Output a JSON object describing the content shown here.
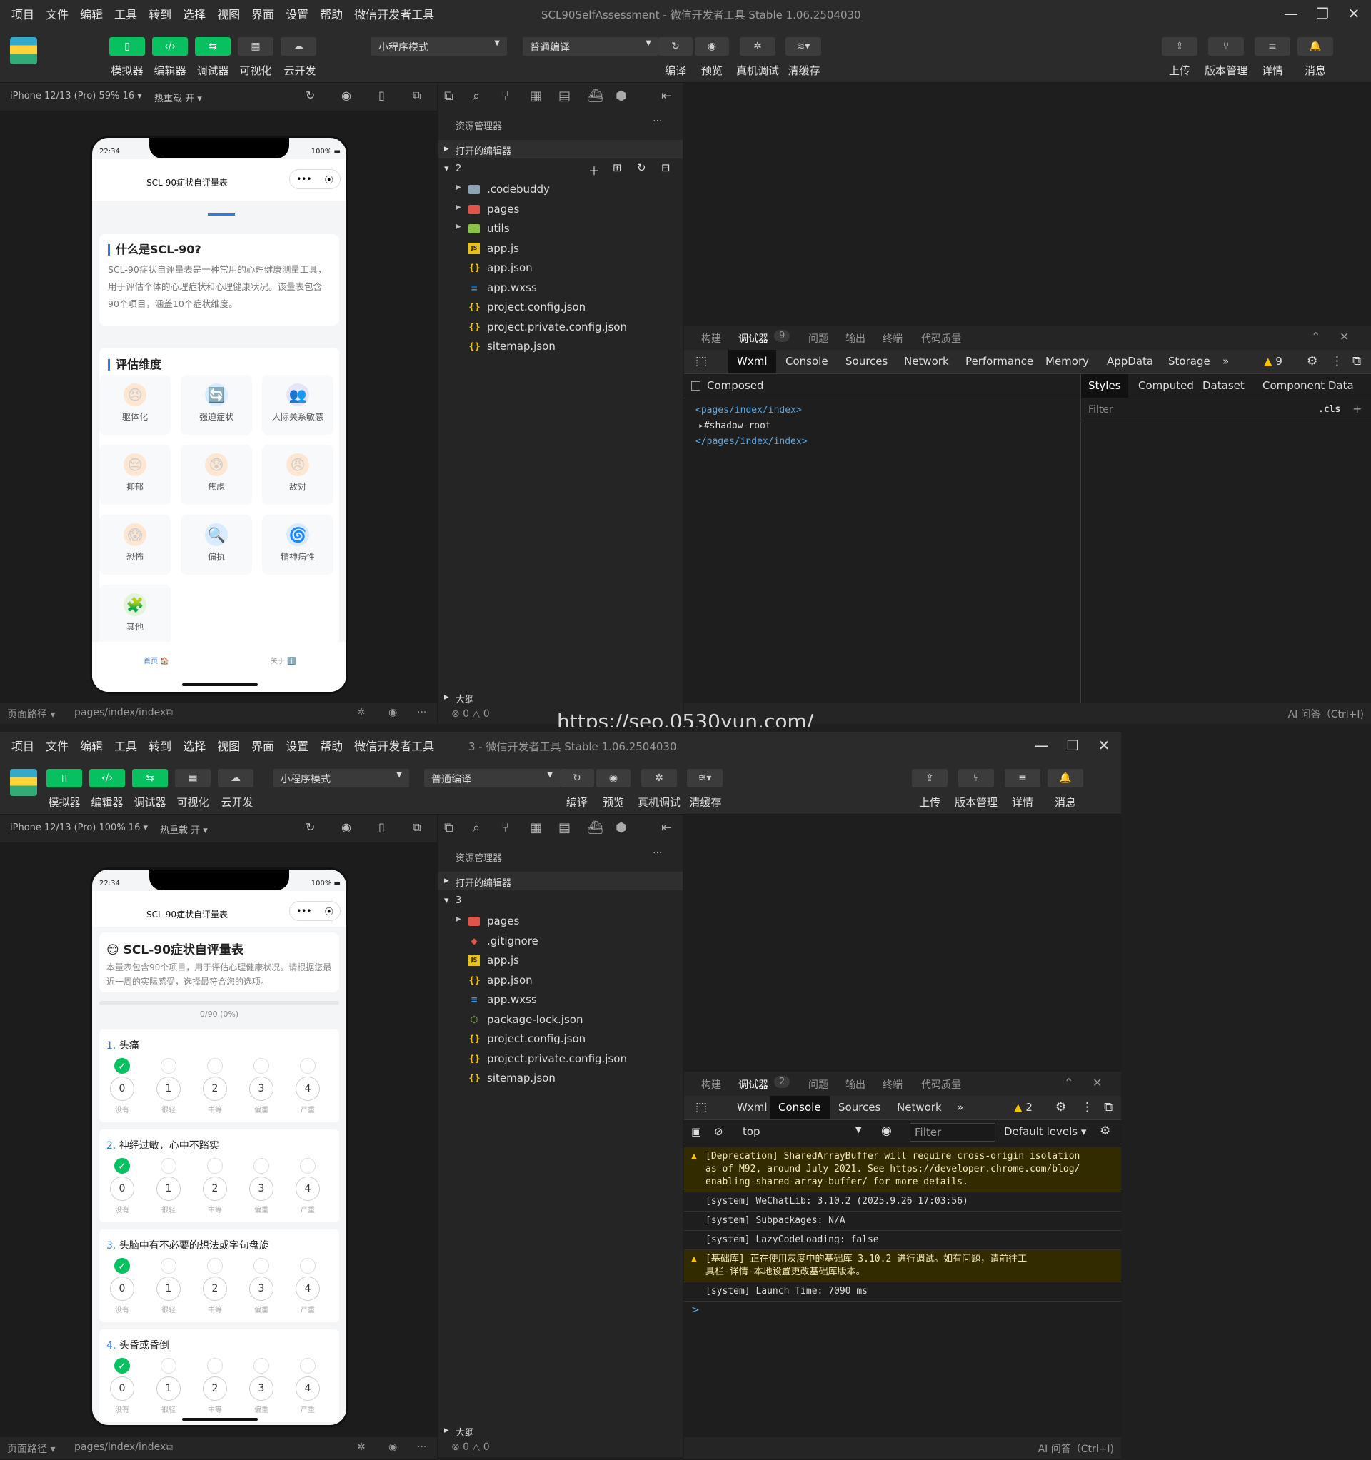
{
  "menu": [
    "项目",
    "文件",
    "编辑",
    "工具",
    "转到",
    "选择",
    "视图",
    "界面",
    "设置",
    "帮助",
    "微信开发者工具"
  ],
  "toolbar": {
    "simulator": "模拟器",
    "editor": "编辑器",
    "debugger": "调试器",
    "visual": "可视化",
    "cloud": "云开发",
    "compile": "编译",
    "preview": "预览",
    "real_debug": "真机调试",
    "clear_cache": "清缓存",
    "upload": "上传",
    "version": "版本管理",
    "details": "详情",
    "messages": "消息",
    "mode": "小程序模式",
    "compile_mode": "普通编译"
  },
  "sim": {
    "hot_reload": "热重载 开 ▾",
    "time": "22:34",
    "battery": "100%",
    "title": "SCL-90症状自评量表",
    "capsule_dots": "•••",
    "capsule_circle": "⦿",
    "page_path_label": "页面路径 ▾",
    "page_path": "pages/index/index"
  },
  "explorer": {
    "title": "资源管理器",
    "open_editors": "打开的编辑器",
    "outline": "大纲",
    "more": "···"
  },
  "devtools": {
    "build": "构建",
    "debugger": "调试器",
    "problems": "问题",
    "output": "输出",
    "terminal": "终端",
    "quality": "代码质量",
    "wxml": "Wxml",
    "console": "Console",
    "sources": "Sources",
    "network": "Network",
    "performance": "Performance",
    "memory": "Memory",
    "appdata": "AppData",
    "storage": "Storage",
    "more": "»",
    "ai": "AI 问答（Ctrl+I)",
    "errors": "⊗ 0 △ 0"
  },
  "w1": {
    "title": "SCL90SelfAssessment - 微信开发者工具 Stable 1.06.2504030",
    "device": "iPhone 12/13 (Pro) 59% 16 ▾",
    "battery": "100%",
    "folder": "2",
    "files": [
      {
        "name": ".codebuddy",
        "icon": "folder",
        "color": "#8fa3b8"
      },
      {
        "name": "pages",
        "icon": "folder",
        "color": "#e0554a"
      },
      {
        "name": "utils",
        "icon": "folder",
        "color": "#8bc34a"
      },
      {
        "name": "app.js",
        "icon": "JS",
        "color": "#e8c21a"
      },
      {
        "name": "app.json",
        "icon": "{}",
        "color": "#e8c21a"
      },
      {
        "name": "app.wxss",
        "icon": "≡",
        "color": "#3d9be9"
      },
      {
        "name": "project.config.json",
        "icon": "{}",
        "color": "#e8c21a"
      },
      {
        "name": "project.private.config.json",
        "icon": "{}",
        "color": "#e8c21a"
      },
      {
        "name": "sitemap.json",
        "icon": "{}",
        "color": "#e8c21a"
      }
    ],
    "debug_count": "9",
    "warn_count": "9",
    "composed": "Composed",
    "wxml_lines": [
      "<pages/index/index>",
      "▸#shadow-root",
      "</pages/index/index>"
    ],
    "styles_tabs": [
      "Styles",
      "Computed",
      "Dataset",
      "Component Data"
    ],
    "filter": "Filter",
    "cls": ".cls",
    "plus": "+",
    "what_title": "什么是SCL-90?",
    "what_text": "SCL-90症状自评量表是一种常用的心理健康测量工具，用于评估个体的心理症状和心理健康状况。该量表包含90个项目，涵盖10个症状维度。",
    "dims_title": "评估维度",
    "dims": [
      {
        "label": "躯体化",
        "icon": "😣",
        "bg": "#fde7d2"
      },
      {
        "label": "强迫症状",
        "icon": "🔄",
        "bg": "#d9ecff"
      },
      {
        "label": "人际关系敏感",
        "icon": "👥",
        "bg": "#e8e4f7"
      },
      {
        "label": "抑郁",
        "icon": "😔",
        "bg": "#fde7d2"
      },
      {
        "label": "焦虑",
        "icon": "😰",
        "bg": "#fde7d2"
      },
      {
        "label": "敌对",
        "icon": "😠",
        "bg": "#fde7d2"
      },
      {
        "label": "恐怖",
        "icon": "😱",
        "bg": "#fde7d2"
      },
      {
        "label": "偏执",
        "icon": "🔍",
        "bg": "#d9ecff"
      },
      {
        "label": "精神病性",
        "icon": "🌀",
        "bg": "#d9ecff"
      },
      {
        "label": "其他",
        "icon": "🧩",
        "bg": "#e2f5dc"
      }
    ],
    "tab_home": "首页 🏠",
    "tab_about": "关于 ℹ️"
  },
  "w2": {
    "title": "3 - 微信开发者工具 Stable 1.06.2504030",
    "device": "iPhone 12/13 (Pro) 100% 16 ▾",
    "battery": "100%",
    "folder": "3",
    "files": [
      {
        "name": "pages",
        "icon": "folder",
        "color": "#e0554a"
      },
      {
        "name": ".gitignore",
        "icon": "◆",
        "color": "#e0554a"
      },
      {
        "name": "app.js",
        "icon": "JS",
        "color": "#e8c21a"
      },
      {
        "name": "app.json",
        "icon": "{}",
        "color": "#e8c21a"
      },
      {
        "name": "app.wxss",
        "icon": "≡",
        "color": "#3d9be9"
      },
      {
        "name": "package-lock.json",
        "icon": "⬡",
        "color": "#8bc34a"
      },
      {
        "name": "project.config.json",
        "icon": "{}",
        "color": "#e8c21a"
      },
      {
        "name": "project.private.config.json",
        "icon": "{}",
        "color": "#e8c21a"
      },
      {
        "name": "sitemap.json",
        "icon": "{}",
        "color": "#e8c21a"
      }
    ],
    "debug_count": "2",
    "warn_count": "2",
    "context": "top",
    "filter": "Filter",
    "levels": "Default levels ▾",
    "console_lines": [
      {
        "text": "[Deprecation] SharedArrayBuffer will require cross-origin isolation\nas of M92, around July 2021. See https://developer.chrome.com/blog/\nenabling-shared-array-buffer/ for more details.",
        "warn": true
      },
      {
        "text": "[system] WeChatLib: 3.10.2 (2025.9.26 17:03:56)",
        "warn": false
      },
      {
        "text": "[system] Subpackages: N/A",
        "warn": false
      },
      {
        "text": "[system] LazyCodeLoading: false",
        "warn": false
      },
      {
        "text": "[基础库] 正在使用灰度中的基础库 3.10.2 进行调试。如有问题，请前往工\n具栏-详情-本地设置更改基础库版本。",
        "warn": true
      },
      {
        "text": "[system] Launch Time: 7090 ms",
        "warn": false
      }
    ],
    "prompt": ">",
    "header_title": "SCL-90症状自评量表",
    "header_icon": "😊",
    "header_text": "本量表包含90个项目，用于评估心理健康状况。请根据您最近一周的实际感受，选择最符合您的选项。",
    "progress": "0/90 (0%)",
    "progress_fraction": 0,
    "option_values": [
      "0",
      "1",
      "2",
      "3",
      "4"
    ],
    "option_labels": [
      "没有",
      "很轻",
      "中等",
      "偏重",
      "严重"
    ],
    "questions": [
      {
        "num": "1.",
        "text": "头痛",
        "selected": 0
      },
      {
        "num": "2.",
        "text": "神经过敏，心中不踏实",
        "selected": 0
      },
      {
        "num": "3.",
        "text": "头脑中有不必要的想法或字句盘旋",
        "selected": 0
      },
      {
        "num": "4.",
        "text": "头昏或昏倒",
        "selected": 0
      }
    ]
  },
  "watermark": "https://seo.0530yun.com/"
}
